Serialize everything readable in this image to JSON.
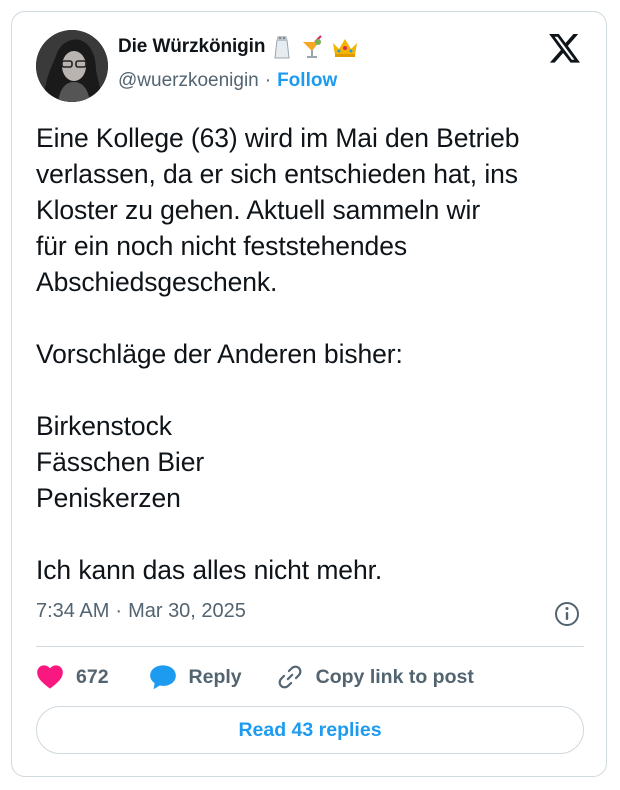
{
  "author": {
    "name": "Die Würzkönigin",
    "handle": "@wuerzkoenigin",
    "follow_label": "Follow",
    "name_emojis": [
      "salt-shaker-icon",
      "tropical-drink-icon",
      "crown-icon"
    ]
  },
  "tweet": {
    "text": "Eine Kollege (63) wird im Mai den Betrieb\nverlassen, da er sich entschieden hat, ins\nKloster zu gehen. Aktuell sammeln wir\nfür ein noch nicht feststehendes\nAbschiedsgeschenk.\n\nVorschläge der Anderen bisher:\n\nBirkenstock\nFässchen Bier\nPeniskerzen\n\nIch kann das alles nicht mehr.",
    "time": "7:34 AM",
    "separator": "·",
    "date": "Mar 30, 2025"
  },
  "actions": {
    "like_count": "672",
    "reply_label": "Reply",
    "copy_label": "Copy link to post"
  },
  "read_replies_label": "Read 43 replies",
  "colors": {
    "accent": "#1d9bf0",
    "like": "#f91880",
    "text": "#0f1419",
    "muted": "#536471",
    "border": "#cfd9de"
  }
}
